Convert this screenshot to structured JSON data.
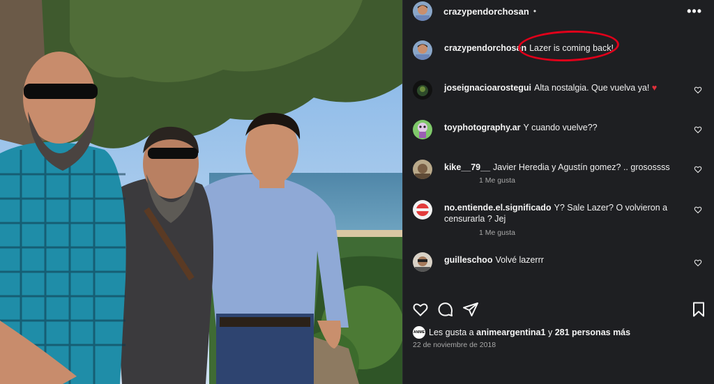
{
  "post": {
    "username": "crazypendorchosan",
    "header_dot": "•",
    "more_label": "•••",
    "caption": "Lazer is coming back!",
    "photo_alt": ""
  },
  "comments": [
    {
      "user": "crazypendorchosan",
      "text": "Lazer is coming back!",
      "likes_text": "",
      "avatar": "author-avatar"
    },
    {
      "user": "joseignacioarostegui",
      "text": "Alta nostalgia. Que vuelva ya!",
      "emoji": "♥",
      "likes_text": "",
      "avatar": "dark-avatar"
    },
    {
      "user": "toyphotography.ar",
      "text": "Y cuando vuelve??",
      "likes_text": "",
      "avatar": "toy-avatar"
    },
    {
      "user": "kike__79__",
      "text": "Javier Heredia y Agustín gomez? .. grosossss",
      "likes_text": "1 Me gusta",
      "avatar": "kike-avatar"
    },
    {
      "user": "no.entiende.el.significado",
      "text": "Y? Sale Lazer? O volvieron a censurarla ? Jej",
      "likes_text": "1 Me gusta",
      "avatar": "nes-avatar"
    },
    {
      "user": "guilleschoo",
      "text": "Volvé lazerrr",
      "likes_text": "",
      "avatar": "guille-avatar"
    }
  ],
  "likes": {
    "prefix": "Les gusta a",
    "first_user": "animeargentina1",
    "middle": "y",
    "rest": "281 personas más",
    "mini_avatar_text": "ANIME"
  },
  "date": "22 de noviembre de 2018",
  "colors": {
    "panel_bg": "#1e1f22",
    "text": "#f5f5f5",
    "muted": "#a8a8a8",
    "annotation_red": "#e0001a",
    "heart_red": "#e0303a"
  }
}
